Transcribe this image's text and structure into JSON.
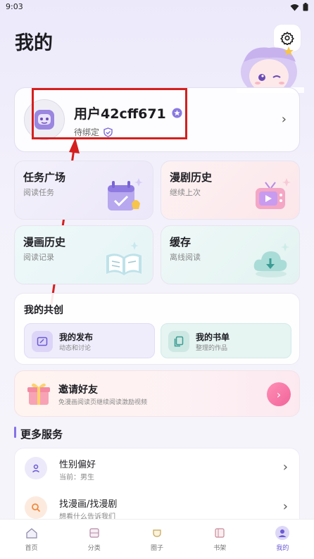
{
  "status_bar": {
    "time": "9:03"
  },
  "header": {
    "title": "我的"
  },
  "profile": {
    "username": "用户42cff671",
    "bind_status": "待绑定"
  },
  "tiles": [
    {
      "title": "任务广场",
      "subtitle": "阅读任务"
    },
    {
      "title": "漫剧历史",
      "subtitle": "继续上次"
    },
    {
      "title": "漫画历史",
      "subtitle": "阅读记录"
    },
    {
      "title": "缓存",
      "subtitle": "离线阅读"
    }
  ],
  "creation": {
    "title": "我的共创",
    "items": [
      {
        "title": "我的发布",
        "desc": "动态和讨论"
      },
      {
        "title": "我的书单",
        "desc": "整理的作品"
      }
    ]
  },
  "invite": {
    "title": "邀请好友",
    "desc": "免漫画阅读页继续阅读激励视频"
  },
  "more_services": {
    "title": "更多服务",
    "items": [
      {
        "title": "性别偏好",
        "subtitle": "当前：男生"
      },
      {
        "title": "找漫画/找漫剧",
        "subtitle": "想看什么告诉我们"
      }
    ]
  },
  "bottom_nav": {
    "items": [
      {
        "label": "首页"
      },
      {
        "label": "分类"
      },
      {
        "label": "圈子"
      },
      {
        "label": "书架"
      },
      {
        "label": "我的"
      }
    ],
    "active_index": 4
  },
  "colors": {
    "accent": "#8572e6",
    "annotation_red": "#d51f1f"
  }
}
